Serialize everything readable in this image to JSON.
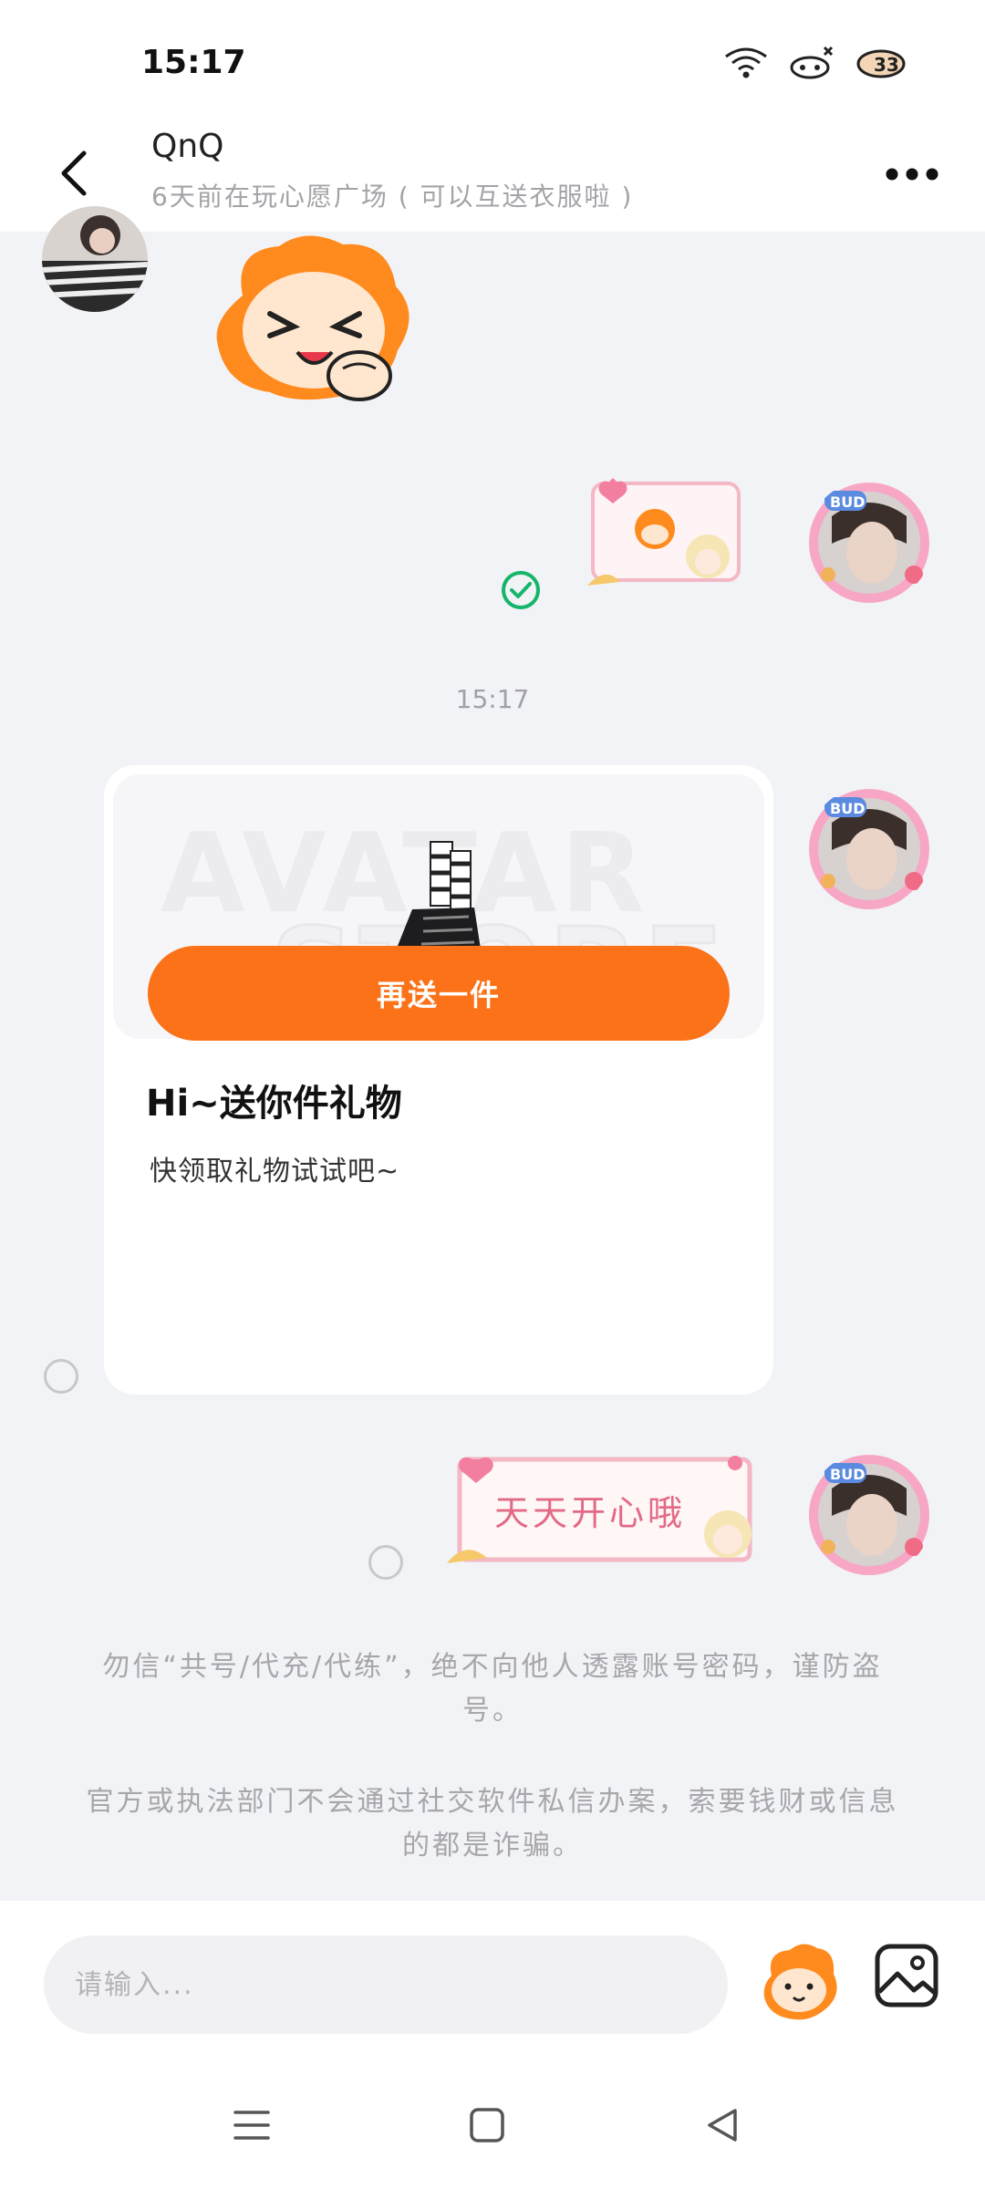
{
  "status_bar": {
    "time": "15:17",
    "icons": [
      "wifi-icon",
      "signal-icon",
      "battery-icon"
    ],
    "battery_level": "33"
  },
  "header": {
    "name": "QnQ",
    "status": "6天前在玩心愿广场 ( 可以互送衣服啦 )"
  },
  "messages": {
    "timestamp": "15:17",
    "text_sticker": "天天开心哦"
  },
  "gift_card": {
    "watermark_line1": "AVATAR",
    "watermark_line2": "STORE",
    "title": "Hi~送你件礼物",
    "subtitle": "快领取礼物试试吧~",
    "button_label": "再送一件"
  },
  "notices": {
    "line1": "勿信“共号/代充/代练”，绝不向他人透露账号密码，谨防盗号。",
    "line2": "官方或执法部门不会通过社交软件私信办案，索要钱财或信息的都是诈骗。"
  },
  "input": {
    "placeholder": "请输入..."
  },
  "colors": {
    "accent": "#fb7219",
    "chat_background": "#f2f3f7",
    "muted_text": "#a6a6ab"
  }
}
